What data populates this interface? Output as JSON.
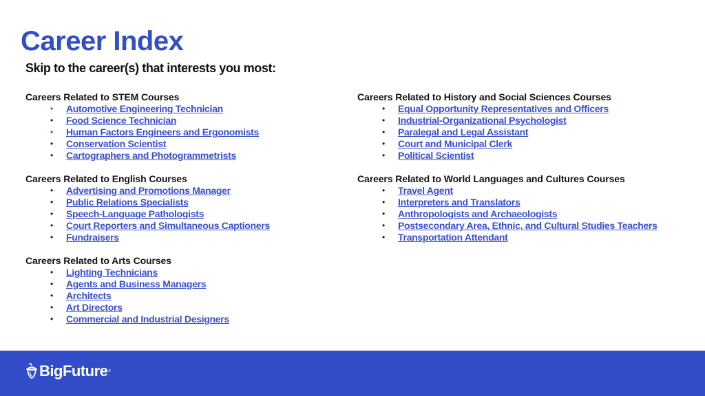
{
  "page": {
    "title": "Career Index",
    "subtitle": "Skip to the career(s) that interests you most:"
  },
  "columns": {
    "left": [
      {
        "heading": "Careers Related to STEM Courses",
        "items": [
          {
            "label": "Automotive Engineering Technician",
            "bullet_color": "blue"
          },
          {
            "label": "Food Science Technician",
            "bullet_color": "black"
          },
          {
            "label": "Human Factors Engineers and Ergonomists",
            "bullet_color": "blue"
          },
          {
            "label": "Conservation Scientist",
            "bullet_color": "black"
          },
          {
            "label": "Cartographers and Photogrammetrists",
            "bullet_color": "black"
          }
        ]
      },
      {
        "heading": "Careers Related to English Courses",
        "items": [
          {
            "label": "Advertising and Promotions Manager",
            "bullet_color": "black"
          },
          {
            "label": "Public Relations Specialists",
            "bullet_color": "black"
          },
          {
            "label": "Speech-Language Pathologists",
            "bullet_color": "black"
          },
          {
            "label": "Court Reporters and Simultaneous Captioners",
            "bullet_color": "black"
          },
          {
            "label": "Fundraisers",
            "bullet_color": "black"
          }
        ]
      },
      {
        "heading": "Careers Related to Arts Courses",
        "items": [
          {
            "label": "Lighting Technicians",
            "bullet_color": "black"
          },
          {
            "label": "Agents and Business Managers",
            "bullet_color": "black"
          },
          {
            "label": "Architects",
            "bullet_color": "black"
          },
          {
            "label": "Art Directors",
            "bullet_color": "black"
          },
          {
            "label": "Commercial and Industrial Designers",
            "bullet_color": "black"
          }
        ]
      }
    ],
    "right": [
      {
        "heading": "Careers Related to History and Social Sciences Courses",
        "items": [
          {
            "label": "Equal Opportunity Representatives and Officers",
            "bullet_color": "black"
          },
          {
            "label": "Industrial-Organizational Psychologist",
            "bullet_color": "black"
          },
          {
            "label": "Paralegal and Legal Assistant",
            "bullet_color": "black"
          },
          {
            "label": "Court and Municipal Clerk",
            "bullet_color": "black"
          },
          {
            "label": "Political Scientist",
            "bullet_color": "black"
          }
        ]
      },
      {
        "heading": "Careers Related to World Languages and Cultures Courses",
        "items": [
          {
            "label": "Travel Agent",
            "bullet_color": "black"
          },
          {
            "label": "Interpreters and Translators",
            "bullet_color": "black"
          },
          {
            "label": "Anthropologists and Archaeologists",
            "bullet_color": "black"
          },
          {
            "label": "Postsecondary Area, Ethnic, and Cultural Studies Teachers",
            "bullet_color": "black"
          },
          {
            "label": "Transportation Attendant",
            "bullet_color": "black"
          }
        ]
      }
    ]
  },
  "footer": {
    "logo_icon": "acorn-icon",
    "logo_text": "BigFuture",
    "logo_tm": "®"
  },
  "colors": {
    "brand_blue": "#324dc7",
    "link_blue": "#3a4fcb",
    "text": "#111111"
  },
  "bullet_glyph": "•"
}
